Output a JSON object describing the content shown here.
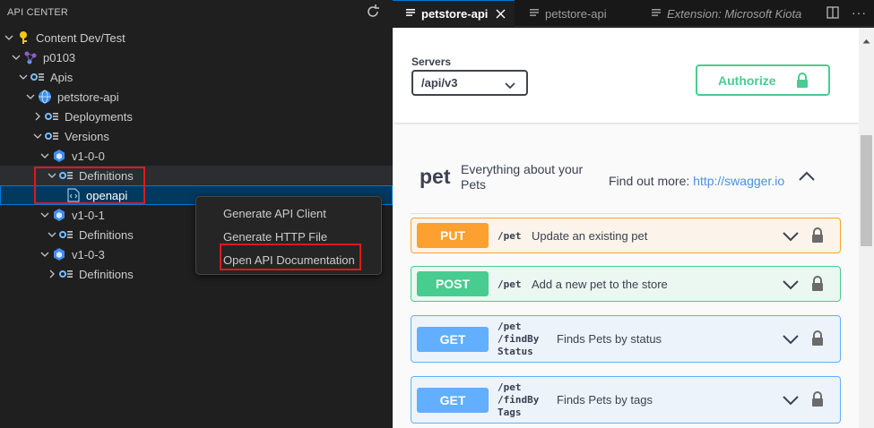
{
  "panel": {
    "title": "API CENTER"
  },
  "tree": [
    {
      "label": "Content Dev/Test",
      "icon": "key-icon"
    },
    {
      "label": "p0103",
      "icon": "api-service-icon"
    },
    {
      "label": "Apis",
      "icon": "list-settings-icon"
    },
    {
      "label": "petstore-api",
      "icon": "globe-icon"
    },
    {
      "label": "Deployments",
      "icon": "list-settings-icon"
    },
    {
      "label": "Versions",
      "icon": "list-settings-icon"
    },
    {
      "label": "v1-0-0",
      "icon": "cube-icon"
    },
    {
      "label": "Definitions",
      "icon": "list-settings-icon"
    },
    {
      "label": "openapi",
      "icon": "file-code-icon"
    },
    {
      "label": "v1-0-1",
      "icon": "cube-icon"
    },
    {
      "label": "Definitions",
      "icon": "list-settings-icon"
    },
    {
      "label": "v1-0-3",
      "icon": "cube-icon"
    },
    {
      "label": "Definitions",
      "icon": "list-settings-icon"
    }
  ],
  "context_menu": {
    "items": [
      "Generate API Client",
      "Generate HTTP File",
      "Open API Documentation"
    ]
  },
  "tabs": [
    {
      "label": "petstore-api",
      "active": true
    },
    {
      "label": "petstore-api",
      "active": false
    },
    {
      "label": "Extension: Microsoft Kiota",
      "active": false
    }
  ],
  "swagger": {
    "servers_label": "Servers",
    "server_value": "/api/v3",
    "authorize_label": "Authorize",
    "tag": {
      "name": "pet",
      "description": "Everything about your Pets",
      "find_more": "Find out more:",
      "link": "http://swagger.io"
    },
    "operations": [
      {
        "method": "PUT",
        "path": "/pet",
        "summary": "Update an existing pet"
      },
      {
        "method": "POST",
        "path": "/pet",
        "summary": "Add a new pet to the store"
      },
      {
        "method": "GET",
        "path": "/pet\n/findBy\nStatus",
        "summary": "Finds Pets by status"
      },
      {
        "method": "GET",
        "path": "/pet\n/findBy\nTags",
        "summary": "Finds Pets by tags"
      }
    ]
  },
  "colors": {
    "put": "#fca130",
    "post": "#49cc90",
    "get": "#61affe",
    "highlight": "#e01919",
    "accent": "#0078d4"
  }
}
